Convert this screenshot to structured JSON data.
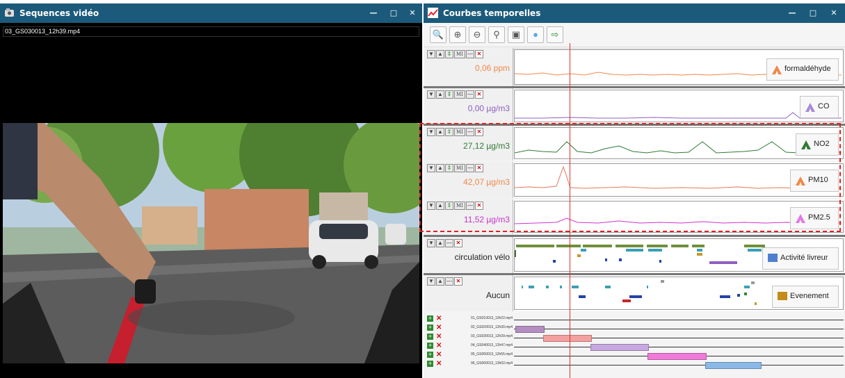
{
  "video_window": {
    "title": "Sequences vidéo",
    "filename": "03_GS030013_12h39.mp4",
    "controls": {
      "minimize": "—",
      "maximize": "□",
      "close": "✕"
    }
  },
  "chart_window": {
    "title": "Courbes temporelles",
    "controls": {
      "minimize": "—",
      "maximize": "□",
      "close": "✕"
    },
    "toolbar": [
      "zoom-icon",
      "zoom-in-icon",
      "zoom-out-icon",
      "zoom-reset-icon",
      "screenshot-icon",
      "comment-icon",
      "export-icon"
    ],
    "track_controls": {
      "down": "▼",
      "up": "▲",
      "move": "⇕",
      "mi": "MI",
      "minus": "—",
      "close": "✕"
    },
    "tracks": [
      {
        "name": "formaldehyde",
        "value": "0,06 ppm",
        "legend": "formaldéhyde",
        "color": "#f08848"
      },
      {
        "name": "co",
        "value": "0,00 µg/m3",
        "legend": "CO",
        "color": "#8e5fc0"
      },
      {
        "name": "no2",
        "value": "27,12 µg/m3",
        "legend": "NO2",
        "color": "#2f7a34"
      },
      {
        "name": "pm10",
        "value": "42,07 µg/m3",
        "legend": "PM10",
        "color": "#f08848"
      },
      {
        "name": "pm25",
        "value": "11,52 µg/m3",
        "legend": "PM2.5",
        "color": "#cc33cc"
      }
    ],
    "activity_tracks": [
      {
        "name": "activite",
        "label": "circulation vélo",
        "legend": "Activité livreur",
        "color": "#4f7fd0"
      },
      {
        "name": "evenement",
        "label": "Aucun",
        "legend": "Evenement",
        "color": "#c48a1a"
      }
    ],
    "video_ribbons": [
      {
        "file": "01_GS010013_12h22.mp4",
        "color": "#ffffff",
        "start": 0.0,
        "end": 0.0
      },
      {
        "file": "02_GS020013_12h30.mp4",
        "color": "#b48ec0",
        "start": 0.0,
        "end": 0.085
      },
      {
        "file": "03_GS030013_12h39.mp4",
        "color": "#f4a0a0",
        "start": 0.085,
        "end": 0.23
      },
      {
        "file": "04_GS040013_12h47.mp4",
        "color": "#c8a8e0",
        "start": 0.23,
        "end": 0.405
      },
      {
        "file": "05_GS050013_12h55.mp4",
        "color": "#f07ad8",
        "start": 0.405,
        "end": 0.58
      },
      {
        "file": "06_GS060013_13h02.mp4",
        "color": "#8ab8e8",
        "start": 0.58,
        "end": 0.75
      }
    ]
  }
}
